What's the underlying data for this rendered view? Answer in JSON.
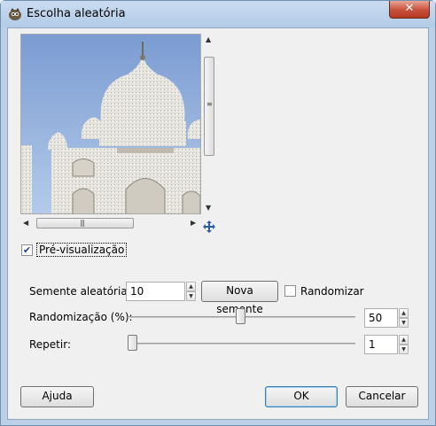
{
  "window": {
    "title": "Escolha aleatória",
    "close_glyph": "✕"
  },
  "preview": {
    "checkbox_label": "Pré-visualização",
    "checked": true,
    "image_name": "taj-mahal-preview",
    "nav_icon": "move-icon"
  },
  "seed": {
    "label": "Semente aleatória:",
    "value": "10",
    "new_seed_button": "Nova semente",
    "randomize_label": "Randomizar",
    "randomize_checked": false
  },
  "randomization": {
    "label": "Randomização (%):",
    "value": "50",
    "level": 50
  },
  "repeat": {
    "label": "Repetir:",
    "value": "1",
    "level": 1
  },
  "buttons": {
    "help": "Ajuda",
    "ok": "OK",
    "cancel": "Cancelar"
  },
  "colors": {
    "titlebar": "#bcd1e8",
    "default_border": "#3c7fb1",
    "close": "#c7503b"
  }
}
